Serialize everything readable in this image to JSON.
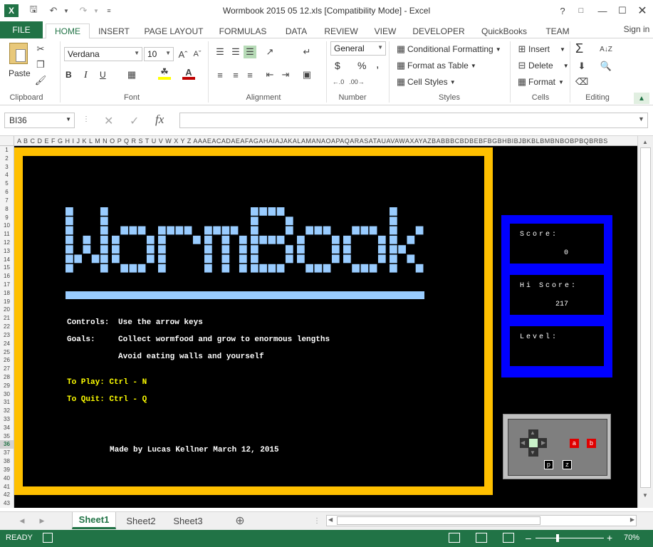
{
  "window": {
    "title": "Wormbook 2015 05 12.xls  [Compatibility Mode] - Excel",
    "help": "?",
    "sign_in": "Sign in"
  },
  "tabs": [
    "FILE",
    "HOME",
    "INSERT",
    "PAGE LAYOUT",
    "FORMULAS",
    "DATA",
    "REVIEW",
    "VIEW",
    "DEVELOPER",
    "QuickBooks",
    "TEAM"
  ],
  "ribbon": {
    "clipboard": {
      "paste_label": "Paste",
      "group": "Clipboard"
    },
    "font": {
      "name": "Verdana",
      "size": "10",
      "group": "Font",
      "bold": "B",
      "italic": "I",
      "underline": "U"
    },
    "alignment": {
      "group": "Alignment"
    },
    "number": {
      "format": "General",
      "group": "Number",
      "currency": "$",
      "percent": "%",
      "comma": ","
    },
    "styles": {
      "conditional": "Conditional Formatting",
      "format_table": "Format as Table",
      "cell_styles": "Cell Styles",
      "group": "Styles"
    },
    "cells": {
      "insert": "Insert",
      "delete": "Delete",
      "format": "Format",
      "group": "Cells"
    },
    "editing": {
      "group": "Editing"
    }
  },
  "formula_bar": {
    "name_box": "BI36",
    "fx": "fx",
    "value": ""
  },
  "columns_text": "A B C D E F G H I J K L M N O P Q R S T U V W X Y Z AAAEACADAEAFAGAHAIAJAKALAMANAOAPAQARASATAUAVAWAXAYAZBABBBCBDBEBFBGBHBIBJBKBLBMBNBOBPBQBRBS",
  "selected_row": 36,
  "rows": 43,
  "game": {
    "title_letters": "WormBook",
    "controls_label": "Controls:",
    "controls_text": "Use the arrow keys",
    "goals_label": "Goals:",
    "goals_line1": "Collect wormfood and grow to enormous lengths",
    "goals_line2": "Avoid eating walls and yourself",
    "to_play": "To Play: Ctrl - N",
    "to_quit": "To Quit: Ctrl - Q",
    "credit": "Made by Lucas Kellner March 12, 2015",
    "score_label": "Score:",
    "score_value": "0",
    "hiscore_label": "Hi Score:",
    "hiscore_value": "217",
    "level_label": "Level:",
    "level_value": "",
    "keys": {
      "a": "a",
      "b": "b",
      "p": "p",
      "z": "z"
    },
    "colors": {
      "frame": "#ffc000",
      "title": "#99ccff",
      "panel": "#0000ff",
      "play": "#ffff00"
    }
  },
  "sheets": [
    "Sheet1",
    "Sheet2",
    "Sheet3"
  ],
  "status": {
    "ready": "READY",
    "zoom": "70%"
  }
}
